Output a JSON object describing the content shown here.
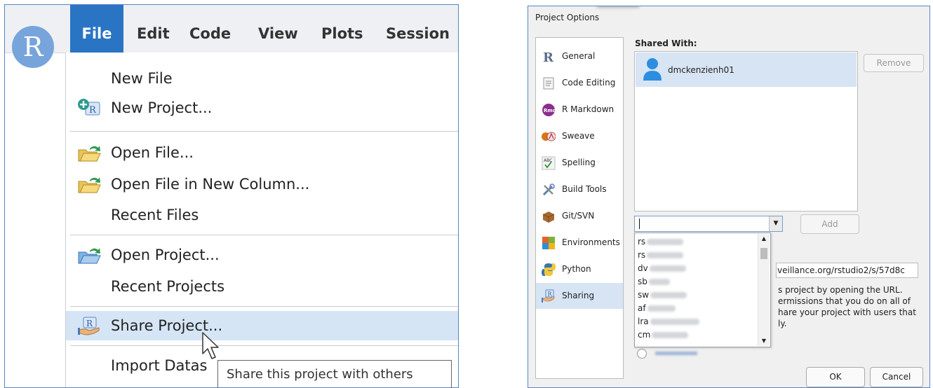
{
  "left": {
    "logo_letter": "R",
    "menubar": [
      "File",
      "Edit",
      "Code",
      "View",
      "Plots",
      "Session"
    ],
    "menu": {
      "new_file": "New File",
      "new_project": "New Project...",
      "open_file": "Open File...",
      "open_file_new_column": "Open File in New Column...",
      "recent_files": "Recent Files",
      "open_project": "Open Project...",
      "recent_projects": "Recent Projects",
      "share_project": "Share Project...",
      "import_dataset": "Import Datas"
    },
    "tooltip": "Share this project with others",
    "colors": {
      "accent": "#2a74c4",
      "highlight": "#d5e5f6"
    }
  },
  "right": {
    "title": "Project Options",
    "nav": [
      {
        "label": "General",
        "icon": "r-logo-icon"
      },
      {
        "label": "Code Editing",
        "icon": "code-editing-icon"
      },
      {
        "label": "R Markdown",
        "icon": "rmarkdown-icon"
      },
      {
        "label": "Sweave",
        "icon": "sweave-icon"
      },
      {
        "label": "Spelling",
        "icon": "spelling-icon"
      },
      {
        "label": "Build Tools",
        "icon": "build-tools-icon"
      },
      {
        "label": "Git/SVN",
        "icon": "git-svn-icon"
      },
      {
        "label": "Environments",
        "icon": "environments-icon"
      },
      {
        "label": "Python",
        "icon": "python-icon"
      },
      {
        "label": "Sharing",
        "icon": "sharing-icon"
      }
    ],
    "selected_nav": "Sharing",
    "shared_with_label": "Shared With:",
    "shared_users": [
      "dmckenzienh01"
    ],
    "remove_label": "Remove",
    "add_label": "Add",
    "combo_value": "",
    "dropdown_items": [
      "rs",
      "rs",
      "dv",
      "sb",
      "sw",
      "af",
      "lra",
      "cm"
    ],
    "url_text": "veillance.org/rstudio2/s/57d8c",
    "info_lines": [
      "s project by opening the URL.",
      "ermissions that you do on all of",
      "hare your project with users that",
      "ly."
    ],
    "ok_label": "OK",
    "cancel_label": "Cancel"
  }
}
